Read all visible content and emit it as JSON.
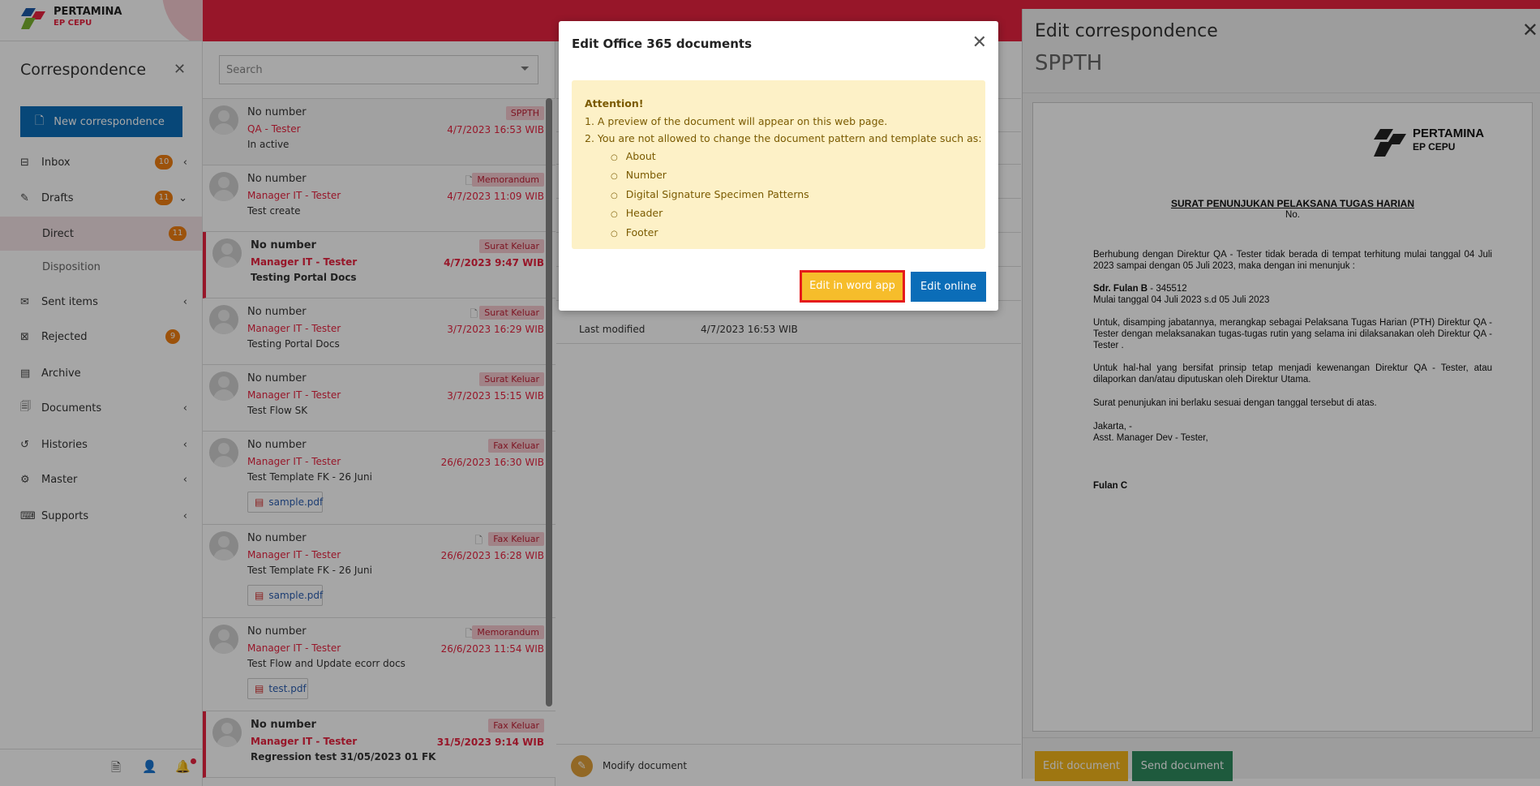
{
  "app": {
    "logo_line1": "PERTAMINA",
    "logo_line2": "EP CEPU"
  },
  "colors": {
    "brand_red": "#e8233f",
    "primary_blue": "#0b6db8",
    "badge_orange": "#f07f12",
    "warning_yellow": "#f6bd2b",
    "success_green": "#2f8a5f"
  },
  "sidebar": {
    "title": "Correspondence",
    "new_button": "New correspondence",
    "items": [
      {
        "label": "Inbox",
        "icon": "inbox-icon",
        "badge": "10",
        "chevron": "chevron-left-icon"
      },
      {
        "label": "Drafts",
        "icon": "drafts-icon",
        "badge": "11",
        "chevron": "chevron-down-icon"
      },
      {
        "label": "Direct",
        "badge": "11"
      },
      {
        "label": "Disposition"
      },
      {
        "label": "Sent items",
        "icon": "sent-icon",
        "chevron": "chevron-left-icon"
      },
      {
        "label": "Rejected",
        "icon": "rejected-icon",
        "badge": "9"
      },
      {
        "label": "Archive",
        "icon": "archive-icon"
      },
      {
        "label": "Documents",
        "icon": "documents-icon",
        "chevron": "chevron-left-icon"
      },
      {
        "label": "Histories",
        "icon": "history-icon",
        "chevron": "chevron-left-icon"
      },
      {
        "label": "Master",
        "icon": "master-icon",
        "chevron": "chevron-left-icon"
      },
      {
        "label": "Supports",
        "icon": "support-icon",
        "chevron": "chevron-left-icon"
      }
    ]
  },
  "list": {
    "search_placeholder": "Search",
    "items": [
      {
        "number": "No number",
        "from": "QA - Tester",
        "subject": "In active",
        "category": "SPPTH",
        "date": "4/7/2023 16:53 WIB"
      },
      {
        "number": "No number",
        "from": "Manager IT - Tester",
        "subject": "Test create",
        "category": "Memorandum",
        "date": "4/7/2023 11:09 WIB"
      },
      {
        "number": "No number",
        "from": "Manager IT - Tester",
        "subject": "Testing Portal Docs",
        "category": "Surat Keluar",
        "date": "4/7/2023 9:47 WIB"
      },
      {
        "number": "No number",
        "from": "Manager IT - Tester",
        "subject": "Testing Portal Docs",
        "category": "Surat Keluar",
        "date": "3/7/2023 16:29 WIB"
      },
      {
        "number": "No number",
        "from": "Manager IT - Tester",
        "subject": "Test Flow SK",
        "category": "Surat Keluar",
        "date": "3/7/2023 15:15 WIB"
      },
      {
        "number": "No number",
        "from": "Manager IT - Tester",
        "subject": "Test Template FK - 26 Juni",
        "category": "Fax Keluar",
        "date": "26/6/2023 16:30 WIB",
        "attachment": "sample.pdf"
      },
      {
        "number": "No number",
        "from": "Manager IT - Tester",
        "subject": "Test Template FK - 26 Juni",
        "category": "Fax Keluar",
        "date": "26/6/2023 16:28 WIB",
        "attachment": "sample.pdf"
      },
      {
        "number": "No number",
        "from": "Manager IT - Tester",
        "subject": "Test Flow and Update ecorr docs",
        "category": "Memorandum",
        "date": "26/6/2023 11:54 WIB",
        "attachment": "test.pdf"
      },
      {
        "number": "No number",
        "from": "Manager IT - Tester",
        "subject": "Regression test 31/05/2023 01 FK",
        "category": "Fax Keluar",
        "date": "31/5/2023 9:14 WIB"
      }
    ]
  },
  "detail": {
    "last_modified_label": "Last modified",
    "last_modified_value": "4/7/2023 16:53 WIB",
    "modify_label": "Modify document"
  },
  "edit_panel": {
    "title": "Edit correspondence",
    "subtitle": "SPPTH",
    "doc": {
      "logo_line1": "PERTAMINA",
      "logo_line2": "EP CEPU",
      "title": "SURAT PENUNJUKAN PELAKSANA TUGAS HARIAN",
      "number": "No.",
      "p1": "Berhubung dengan Direktur QA - Tester tidak berada di tempat terhitung mulai tanggal 04 Juli 2023 sampai dengan 05 Juli 2023, maka dengan ini menunjuk :",
      "appointee_name": "Sdr. Fulan B",
      "appointee_id": " - 345512",
      "p2": "Mulai tanggal 04 Juli 2023 s.d 05 Juli 2023",
      "p3": "Untuk, disamping jabatannya, merangkap sebagai Pelaksana Tugas Harian (PTH) Direktur QA - Tester dengan melaksanakan tugas-tugas rutin yang selama ini dilaksanakan oleh Direktur QA - Tester .",
      "p4": "Untuk hal-hal yang bersifat prinsip tetap menjadi kewenangan Direktur QA - Tester, atau dilaporkan dan/atau diputuskan oleh Direktur Utama.",
      "p5": "Surat penunjukan ini berlaku sesuai dengan tanggal tersebut di atas.",
      "place": "Jakarta, -",
      "position": "Asst. Manager Dev - Tester,",
      "signer": "Fulan C"
    },
    "edit_button": "Edit document",
    "send_button": "Send document"
  },
  "modal": {
    "title": "Edit Office 365 documents",
    "attention": "Attention!",
    "point1": "1. A preview of the document will appear on this web page.",
    "point2": "2. You are not allowed to change the document pattern and template such as:",
    "subpoints": [
      "About",
      "Number",
      "Digital Signature Specimen Patterns",
      "Header",
      "Footer"
    ],
    "word_button": "Edit in word app",
    "online_button": "Edit online"
  }
}
